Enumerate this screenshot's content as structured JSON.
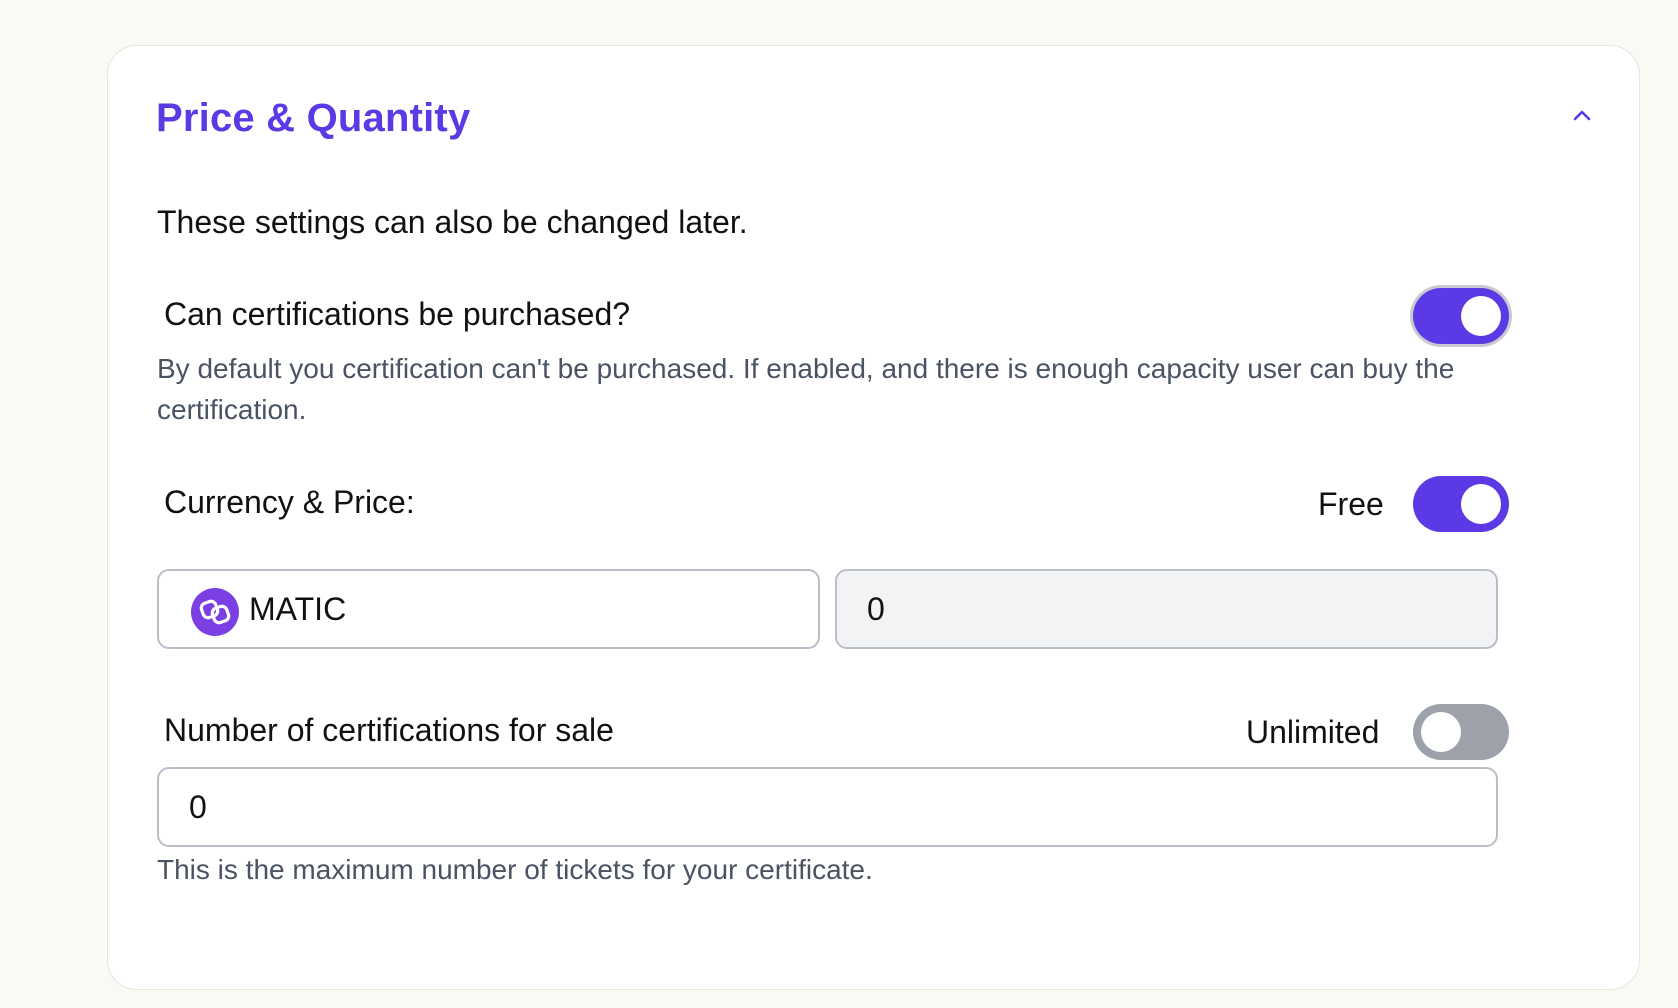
{
  "section": {
    "title": "Price & Quantity",
    "subtitle": "These settings can also be changed later."
  },
  "purchase": {
    "label": "Can certifications be purchased?",
    "enabled": true,
    "helper": "By default you certification can't be purchased. If enabled, and there is enough capacity user can buy the certification."
  },
  "price": {
    "label": "Currency & Price:",
    "free_label": "Free",
    "free_enabled": true,
    "currency": "MATIC",
    "currency_icon": "polygon-matic-icon",
    "amount": "0"
  },
  "quantity": {
    "label": "Number of certifications for sale",
    "unlimited_label": "Unlimited",
    "unlimited_enabled": false,
    "value": "0",
    "helper": "This is the maximum number of tickets for your certificate."
  },
  "colors": {
    "accent": "#5b3ae6",
    "toggle_off": "#9ca1aa",
    "coin": "#7b3fe4",
    "page_background": "#fbf9f3"
  }
}
